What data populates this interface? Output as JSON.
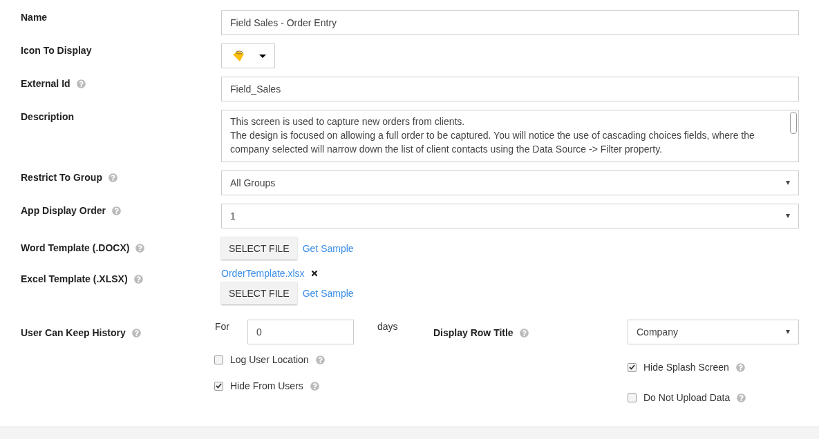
{
  "fields": [
    {
      "kind": "text",
      "label": "Name",
      "help": false,
      "value": "Field Sales - Order Entry"
    },
    {
      "kind": "icon",
      "label": "Icon To Display",
      "help": false
    },
    {
      "kind": "text",
      "label": "External Id",
      "help": true,
      "value": "Field_Sales"
    },
    {
      "kind": "textarea",
      "label": "Description",
      "help": false,
      "lines": [
        "This screen is used to capture new orders from clients.",
        "The design is focused on allowing a full order to be captured.  You will notice the use of cascading choices fields, where the company selected will narrow down the list of client contacts using the Data Source -> Filter property."
      ]
    },
    {
      "kind": "select",
      "label": "Restrict To Group",
      "help": true,
      "value": "All Groups"
    },
    {
      "kind": "select",
      "label": "App Display Order",
      "help": true,
      "value": "1"
    },
    {
      "kind": "file",
      "label": "Word Template (.DOCX)",
      "help": true,
      "button": "SELECT FILE",
      "link": "Get Sample"
    },
    {
      "kind": "file",
      "label": "Excel Template (.XLSX)",
      "help": true,
      "file_name": "OrderTemplate.xlsx",
      "button": "SELECT FILE",
      "link": "Get Sample"
    }
  ],
  "history": {
    "label": "User Can Keep History",
    "for_label": "For",
    "value": "0",
    "unit": "days",
    "row_title": {
      "label": "Display Row Title",
      "value": "Company"
    },
    "left_checks": [
      {
        "label": "Log User Location",
        "checked": false
      },
      {
        "label": "Hide From Users",
        "checked": true
      }
    ],
    "right_checks": [
      {
        "label": "Hide Splash Screen",
        "checked": true
      },
      {
        "label": "Do Not Upload Data",
        "checked": false
      }
    ]
  }
}
